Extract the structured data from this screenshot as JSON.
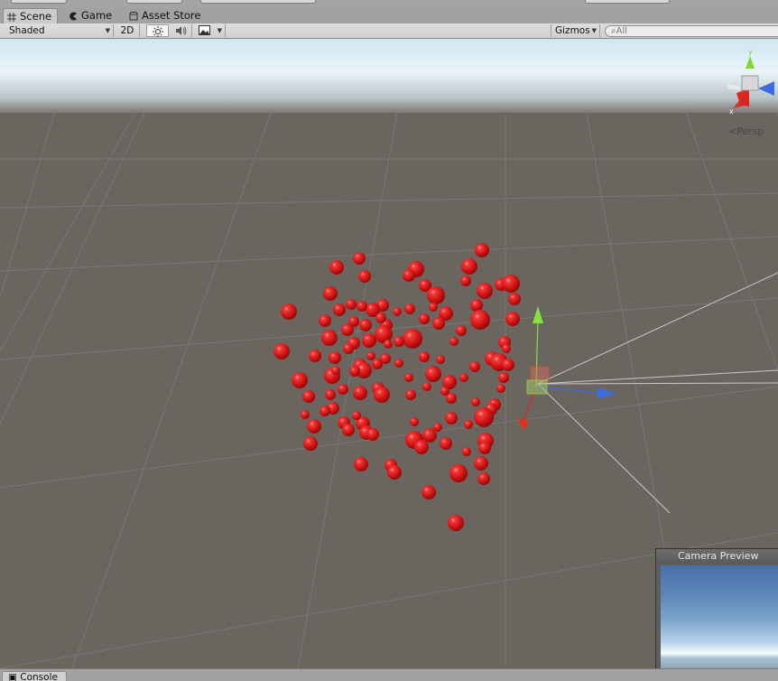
{
  "tabs": [
    {
      "label": "Scene",
      "icon": "hash-icon",
      "active": true
    },
    {
      "label": "Game",
      "icon": "pacman-icon",
      "active": false
    },
    {
      "label": "Asset Store",
      "icon": "store-icon",
      "active": false
    }
  ],
  "toolbar": {
    "shading_mode": "Shaded",
    "mode_2d": "2D",
    "lighting_icon": "sun-icon",
    "audio_icon": "speaker-icon",
    "effects_icon": "image-icon",
    "gizmos_label": "Gizmos",
    "search_placeholder": "All"
  },
  "scene_gizmo": {
    "projection_label": "Persp",
    "axis_labels": [
      "y",
      "x"
    ],
    "colors": {
      "y": "#7fd62c",
      "x": "#e0261e",
      "z": "#3b6de0"
    }
  },
  "camera_preview": {
    "title": "Camera Preview"
  },
  "bottom_tabs": [
    {
      "label": "Console",
      "icon": "console-icon"
    }
  ],
  "scene": {
    "sphere_color": "#e01a1a",
    "object_count": 121
  }
}
